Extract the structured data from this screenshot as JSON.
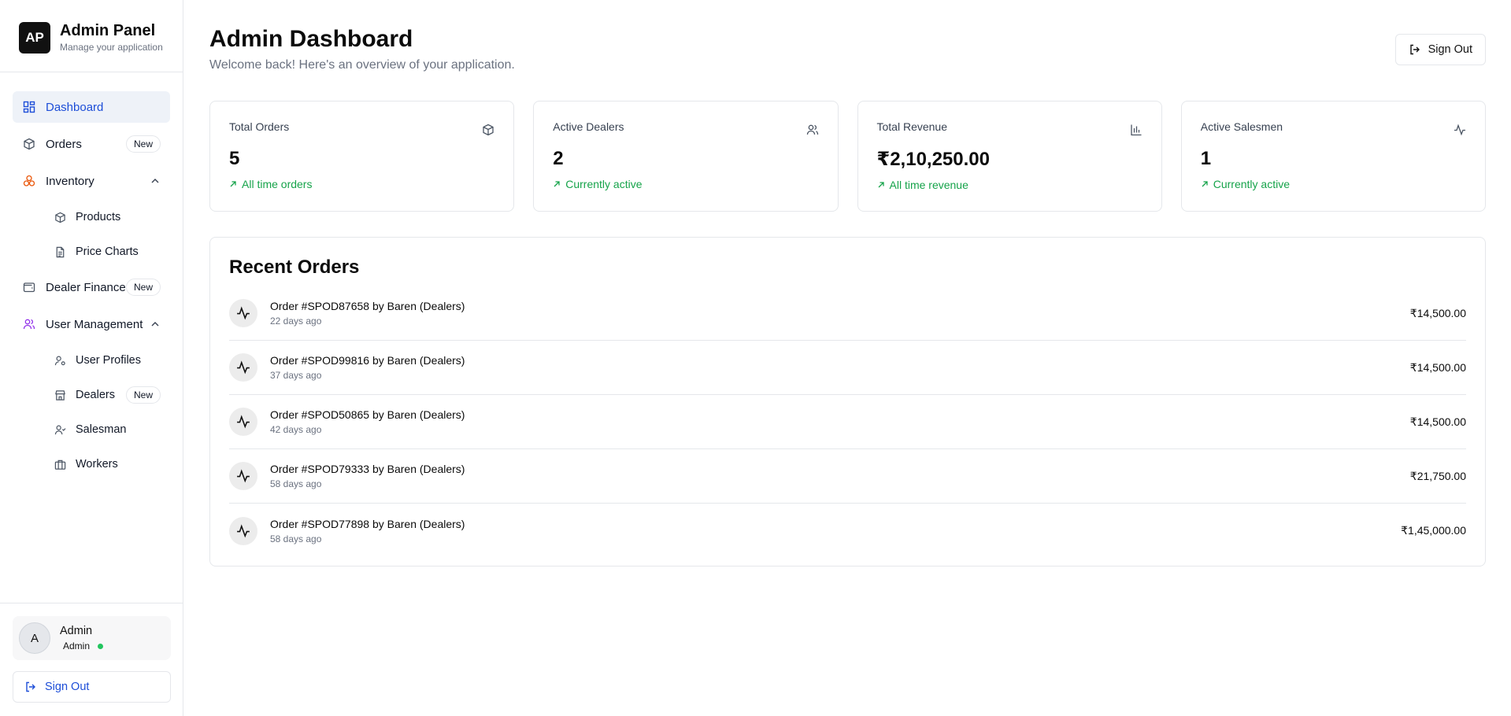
{
  "brand": {
    "logo": "AP",
    "title": "Admin Panel",
    "subtitle": "Manage your application"
  },
  "nav": {
    "dashboard": {
      "label": "Dashboard",
      "icon": "dashboard-icon"
    },
    "orders": {
      "label": "Orders",
      "badge": "New",
      "icon": "box-icon"
    },
    "inventory": {
      "label": "Inventory",
      "icon": "inventory-icon"
    },
    "products": {
      "label": "Products",
      "icon": "box-icon"
    },
    "price_charts": {
      "label": "Price Charts",
      "icon": "document-icon"
    },
    "dealer_finance": {
      "label": "Dealer Finance",
      "badge": "New",
      "icon": "wallet-icon"
    },
    "user_management": {
      "label": "User Management",
      "icon": "users-icon"
    },
    "user_profiles": {
      "label": "User Profiles",
      "icon": "user-settings-icon"
    },
    "dealers": {
      "label": "Dealers",
      "badge": "New",
      "icon": "store-icon"
    },
    "salesman": {
      "label": "Salesman",
      "icon": "user-check-icon"
    },
    "workers": {
      "label": "Workers",
      "icon": "briefcase-icon"
    }
  },
  "user": {
    "initial": "A",
    "name": "Admin",
    "role": "Admin"
  },
  "sidebar_signout": "Sign Out",
  "header": {
    "title": "Admin Dashboard",
    "subtitle": "Welcome back! Here's an overview of your application.",
    "signout": "Sign Out"
  },
  "stats": [
    {
      "label": "Total Orders",
      "value": "5",
      "note": "All time orders",
      "icon": "box-icon"
    },
    {
      "label": "Active Dealers",
      "value": "2",
      "note": "Currently active",
      "icon": "users-icon"
    },
    {
      "label": "Total Revenue",
      "value": "₹2,10,250.00",
      "note": "All time revenue",
      "icon": "bar-chart-icon"
    },
    {
      "label": "Active Salesmen",
      "value": "1",
      "note": "Currently active",
      "icon": "activity-icon"
    }
  ],
  "recent_orders": {
    "title": "Recent Orders",
    "items": [
      {
        "title": "Order #SPOD87658 by Baren (Dealers)",
        "time": "22 days ago",
        "amount": "₹14,500.00"
      },
      {
        "title": "Order #SPOD99816 by Baren (Dealers)",
        "time": "37 days ago",
        "amount": "₹14,500.00"
      },
      {
        "title": "Order #SPOD50865 by Baren (Dealers)",
        "time": "42 days ago",
        "amount": "₹14,500.00"
      },
      {
        "title": "Order #SPOD79333 by Baren (Dealers)",
        "time": "58 days ago",
        "amount": "₹21,750.00"
      },
      {
        "title": "Order #SPOD77898 by Baren (Dealers)",
        "time": "58 days ago",
        "amount": "₹1,45,000.00"
      }
    ]
  },
  "colors": {
    "accent": "#1d4ed8",
    "success": "#16a34a",
    "inventory_icon": "#ea580c",
    "users_icon": "#9333ea"
  }
}
